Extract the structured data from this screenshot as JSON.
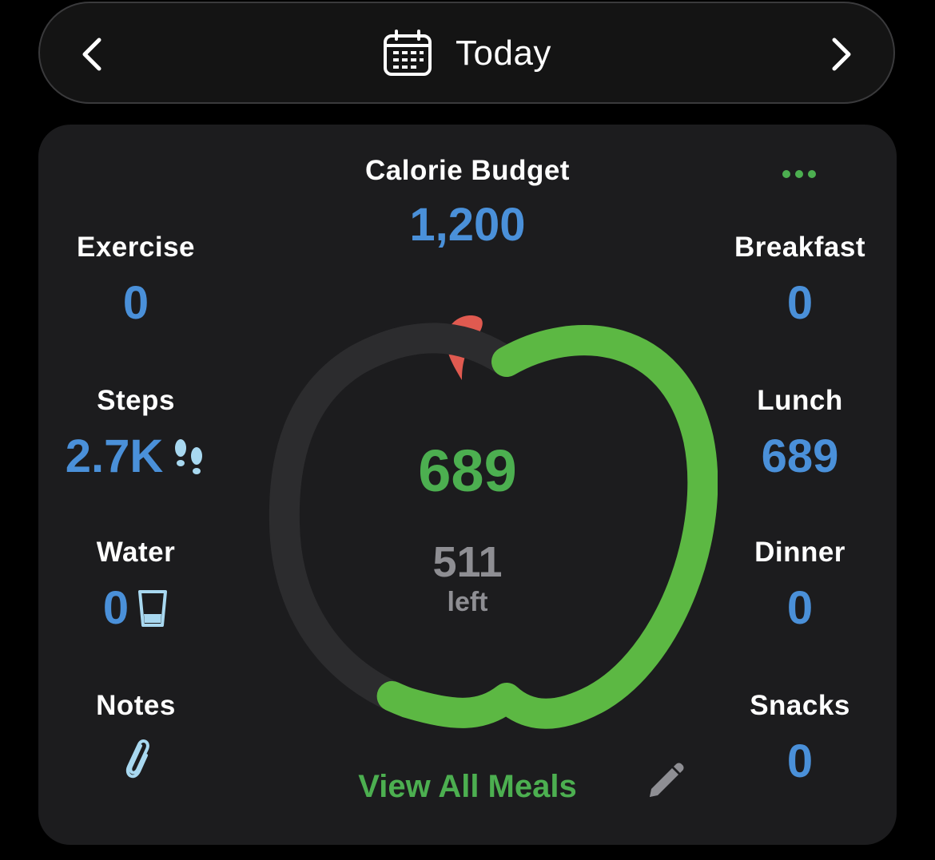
{
  "header": {
    "date_label": "Today",
    "prev_icon": "chevron-left-icon",
    "next_icon": "chevron-right-icon",
    "calendar_icon": "calendar-icon"
  },
  "card": {
    "calorie_budget": {
      "label": "Calorie Budget",
      "value": "1,200"
    },
    "more_icon": "more-dots-icon",
    "left_stats": {
      "exercise": {
        "label": "Exercise",
        "value": "0"
      },
      "steps": {
        "label": "Steps",
        "value": "2.7K",
        "icon": "footsteps-icon"
      },
      "water": {
        "label": "Water",
        "value": "0",
        "icon": "water-glass-icon"
      },
      "notes": {
        "label": "Notes",
        "icon": "paperclip-icon"
      }
    },
    "right_stats": {
      "breakfast": {
        "label": "Breakfast",
        "value": "0"
      },
      "lunch": {
        "label": "Lunch",
        "value": "689"
      },
      "dinner": {
        "label": "Dinner",
        "value": "0"
      },
      "snacks": {
        "label": "Snacks",
        "value": "0"
      }
    },
    "progress": {
      "consumed": "689",
      "remaining": "511",
      "remaining_label": "left",
      "consumed_fraction": 0.574
    },
    "view_all_label": "View All Meals",
    "edit_icon": "pencil-icon"
  },
  "colors": {
    "accent_blue": "#4a90d9",
    "accent_green": "#4caf50",
    "progress_green": "#5cb843",
    "track_gray": "#2c2c2e",
    "stem_red": "#e05a50",
    "card_bg": "#1c1c1e"
  }
}
